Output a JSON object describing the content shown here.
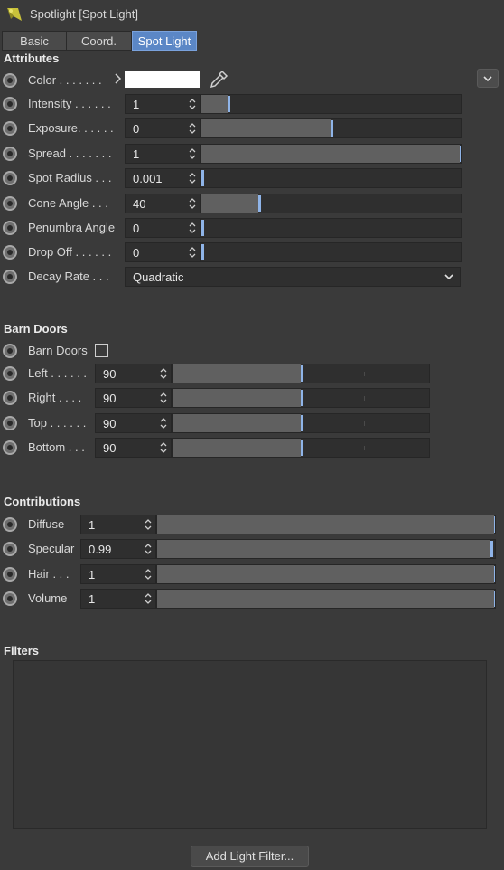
{
  "title": "Spotlight [Spot Light]",
  "tabs": [
    {
      "label": "Basic"
    },
    {
      "label": "Coord."
    },
    {
      "label": "Spot Light"
    }
  ],
  "attributes": {
    "heading": "Attributes",
    "color": {
      "label": "Color . . . . . . .",
      "value": "#ffffff"
    },
    "fields": [
      {
        "label": "Intensity . . . . . .",
        "value": "1",
        "fraction": 0.1
      },
      {
        "label": "Exposure. . . . . .",
        "value": "0",
        "fraction": 0.5
      },
      {
        "label": "Spread . . . . . . .",
        "value": "1",
        "fraction": 1.0
      },
      {
        "label": "Spot Radius . . .",
        "value": "0.001",
        "fraction": 0.0
      },
      {
        "label": "Cone Angle . . .",
        "value": "40",
        "fraction": 0.22
      },
      {
        "label": "Penumbra Angle",
        "value": "0",
        "fraction": 0.0
      },
      {
        "label": "Drop Off . . . . . .",
        "value": "0",
        "fraction": 0.0
      }
    ],
    "decay": {
      "label": "Decay Rate . . .",
      "value": "Quadratic"
    }
  },
  "barn_doors": {
    "heading": "Barn Doors",
    "toggle_label": "Barn Doors",
    "toggle_checked": false,
    "fields": [
      {
        "label": "Left . . . . . .",
        "value": "90",
        "fraction": 0.5
      },
      {
        "label": "Right . . . .",
        "value": "90",
        "fraction": 0.5
      },
      {
        "label": "Top . . . . . .",
        "value": "90",
        "fraction": 0.5
      },
      {
        "label": "Bottom . . .",
        "value": "90",
        "fraction": 0.5
      }
    ]
  },
  "contributions": {
    "heading": "Contributions",
    "fields": [
      {
        "label": "Diffuse",
        "value": "1",
        "fraction": 1.0
      },
      {
        "label": "Specular",
        "value": "0.99",
        "fraction": 0.99
      },
      {
        "label": "Hair . . .",
        "value": "1",
        "fraction": 1.0
      },
      {
        "label": "Volume",
        "value": "1",
        "fraction": 1.0
      }
    ]
  },
  "filters": {
    "heading": "Filters",
    "add_button": "Add Light Filter..."
  },
  "colors": {
    "accent": "#5b87c6",
    "handle": "#8fb4e8",
    "background": "#3a3a3a"
  },
  "icons": [
    "spotlight-icon",
    "eyedropper-icon",
    "chevron-down-icon",
    "expand-arrow-icon",
    "spinner-arrows-icon"
  ]
}
